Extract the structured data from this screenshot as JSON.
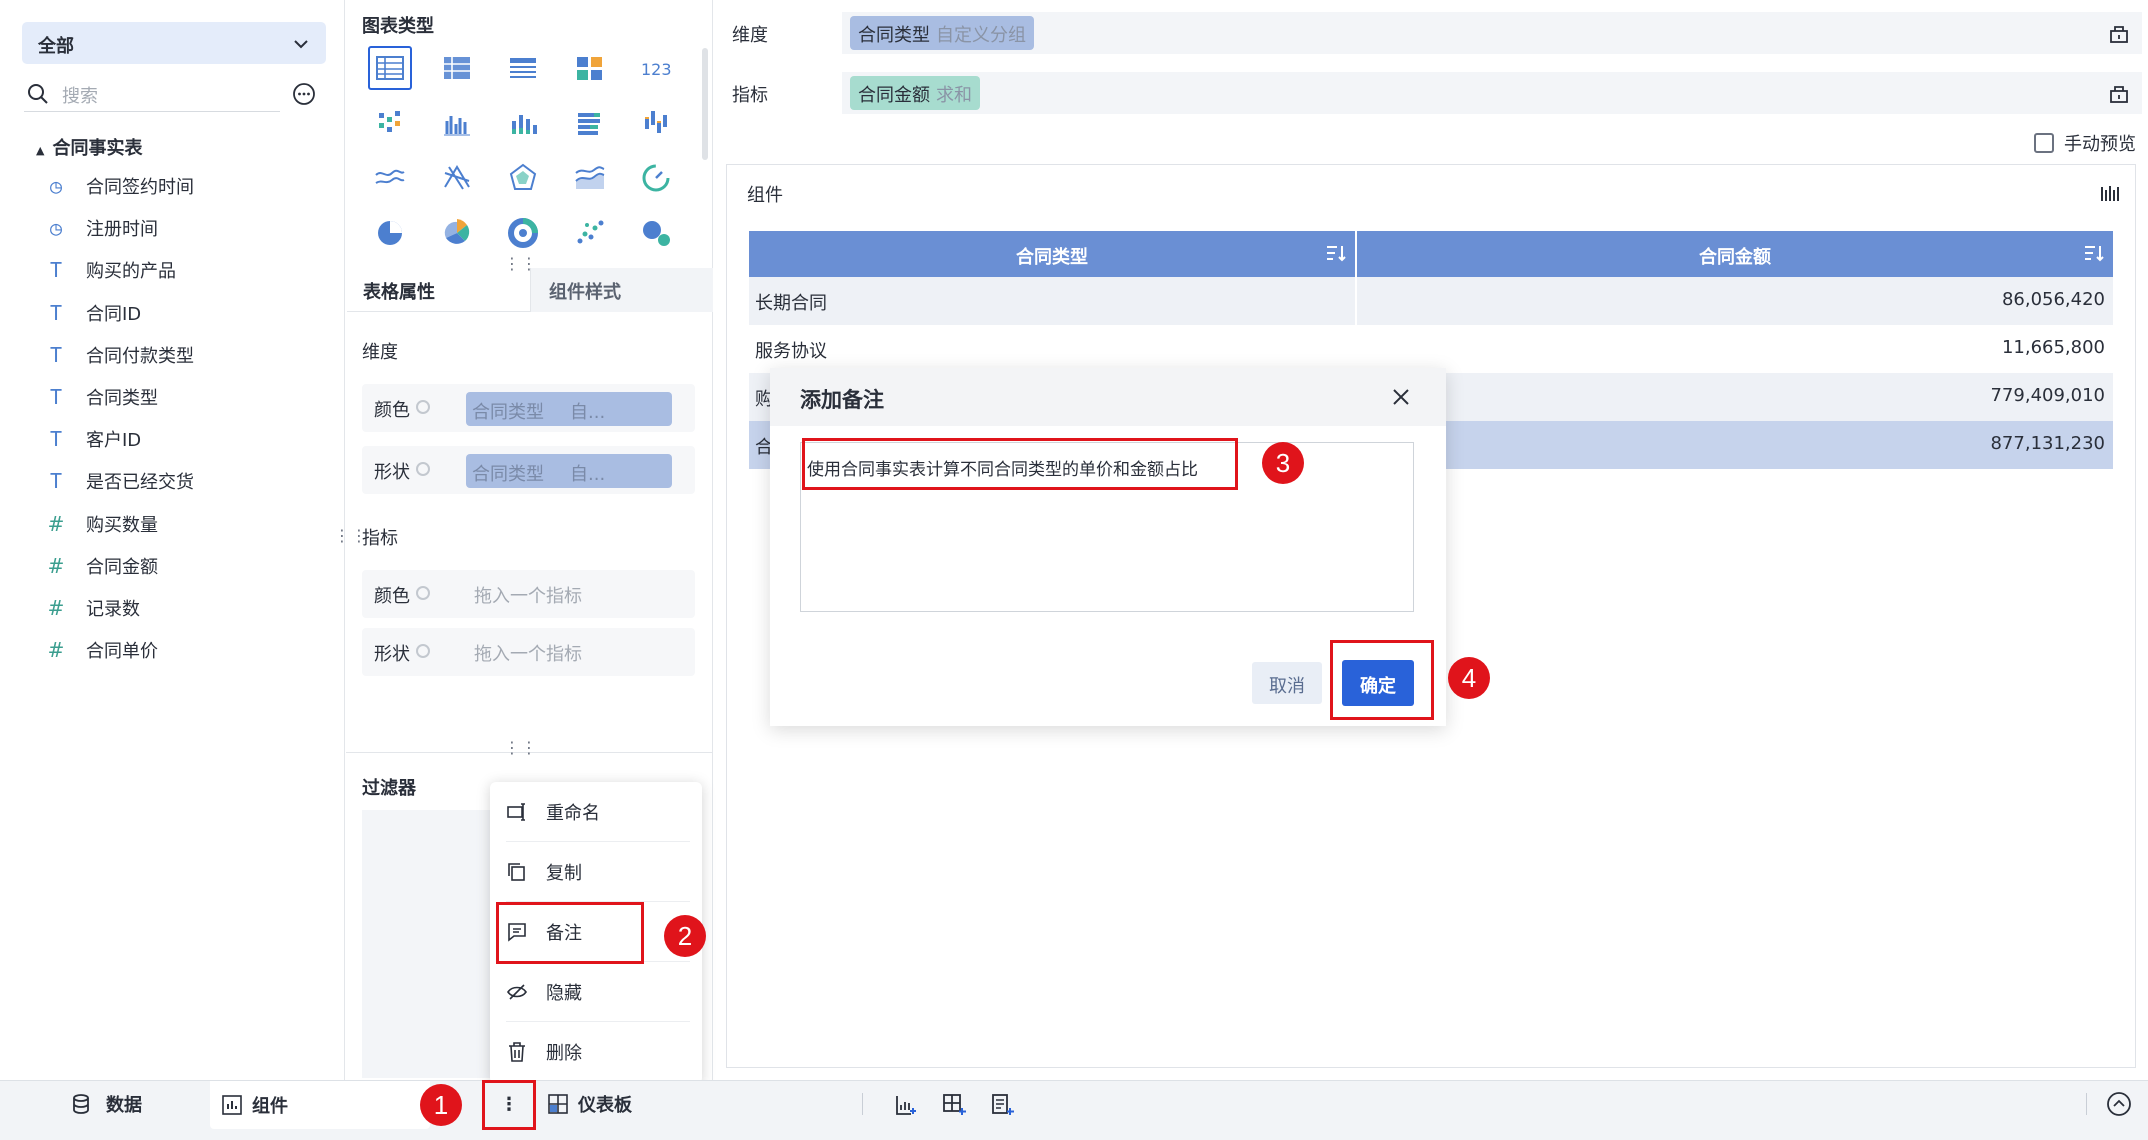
{
  "left_panel": {
    "scope_select": "全部",
    "search_placeholder": "搜索",
    "table_name": "合同事实表",
    "fields": [
      {
        "label": "合同签约时间",
        "icon": "clock-icon"
      },
      {
        "label": "注册时间",
        "icon": "clock-icon"
      },
      {
        "label": "购买的产品",
        "icon": "text-type-icon"
      },
      {
        "label": "合同ID",
        "icon": "text-type-icon"
      },
      {
        "label": "合同付款类型",
        "icon": "text-type-icon"
      },
      {
        "label": "合同类型",
        "icon": "text-type-icon"
      },
      {
        "label": "客户ID",
        "icon": "text-type-icon"
      },
      {
        "label": "是否已经交货",
        "icon": "text-type-icon"
      },
      {
        "label": "购买数量",
        "icon": "number-type-icon"
      },
      {
        "label": "合同金额",
        "icon": "number-type-icon"
      },
      {
        "label": "记录数",
        "icon": "count-icon"
      },
      {
        "label": "合同单价",
        "icon": "calculated-field-icon"
      }
    ]
  },
  "chart_types": {
    "title": "图表类型",
    "selected": "table"
  },
  "props": {
    "tab_table_props": "表格属性",
    "tab_component_style": "组件样式",
    "dimension_label": "维度",
    "color_label": "颜色",
    "shape_label": "形状",
    "dim_chip_field": "合同类型",
    "dim_chip_suffix": "自...",
    "indicator_label": "指标",
    "indicator_placeholder": "拖入一个指标",
    "filter_label": "过滤器"
  },
  "context_menu": {
    "items": [
      {
        "label": "重命名",
        "icon": "rename-icon"
      },
      {
        "label": "复制",
        "icon": "copy-icon"
      },
      {
        "label": "备注",
        "icon": "comment-icon"
      },
      {
        "label": "隐藏",
        "icon": "hide-eye-icon"
      },
      {
        "label": "删除",
        "icon": "trash-icon"
      }
    ]
  },
  "bars": {
    "dimension_key": "维度",
    "dimension_pill_field": "合同类型",
    "dimension_pill_sub": "自定义分组",
    "indicator_key": "指标",
    "indicator_pill_field": "合同金额",
    "indicator_pill_sub": "求和",
    "manual_preview": "手动预览"
  },
  "component": {
    "title": "组件",
    "headers": [
      "合同类型",
      "合同金额"
    ],
    "rows": [
      {
        "c1": "长期合同",
        "c2": "86,056,420"
      },
      {
        "c1": "服务协议",
        "c2": "11,665,800"
      },
      {
        "c1": "购",
        "c2": "779,409,010"
      },
      {
        "c1": "合",
        "c2": "877,131,230"
      }
    ]
  },
  "dialog": {
    "title": "添加备注",
    "text": "使用合同事实表计算不同合同类型的单价和金额占比",
    "cancel": "取消",
    "ok": "确定"
  },
  "bottom_bar": {
    "data_tab": "数据",
    "component_tab": "组件",
    "dashboard_tab": "仪表板"
  },
  "annotations": [
    "1",
    "2",
    "3",
    "4"
  ],
  "colors": {
    "accent": "#2962d9",
    "header": "#6a8fd4",
    "annotation": "#e0141b",
    "dim_pill": "#a9bde2",
    "ind_pill": "#a7dccf"
  }
}
